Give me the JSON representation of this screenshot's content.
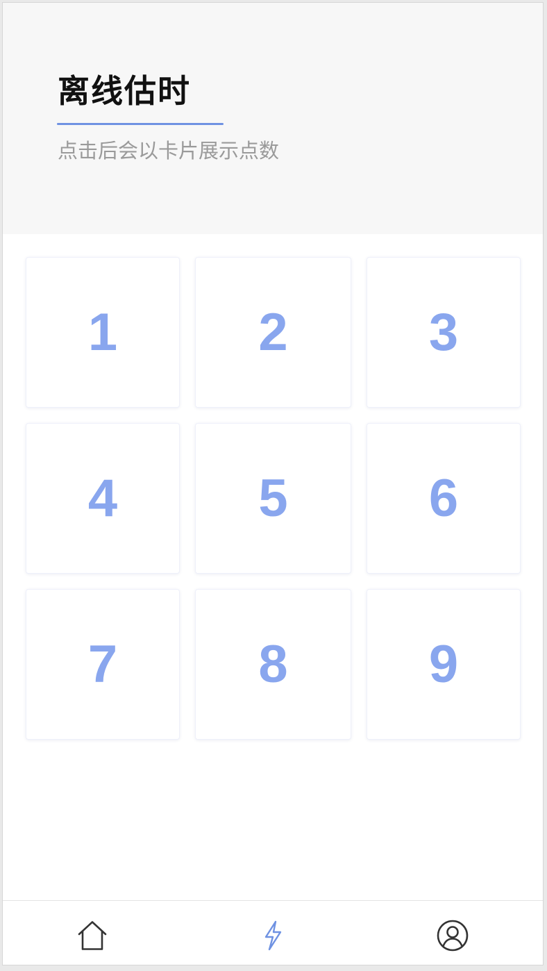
{
  "header": {
    "title": "离线估时",
    "subtitle": "点击后会以卡片展示点数"
  },
  "cards": [
    {
      "value": "1"
    },
    {
      "value": "2"
    },
    {
      "value": "3"
    },
    {
      "value": "4"
    },
    {
      "value": "5"
    },
    {
      "value": "6"
    },
    {
      "value": "7"
    },
    {
      "value": "8"
    },
    {
      "value": "9"
    }
  ],
  "tabbar": {
    "items": [
      {
        "icon": "home-icon",
        "active": false
      },
      {
        "icon": "lightning-icon",
        "active": true
      },
      {
        "icon": "user-icon",
        "active": false
      }
    ]
  },
  "colors": {
    "accent": "#6f92e2",
    "card_number": "#89a6ee",
    "subtitle": "#9a9a9a",
    "header_bg": "#f7f7f7",
    "icon_inactive": "#333333"
  }
}
